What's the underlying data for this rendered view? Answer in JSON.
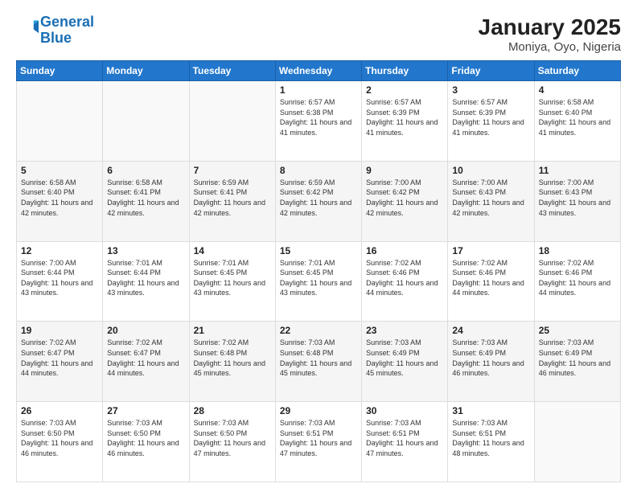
{
  "header": {
    "logo_text_general": "General",
    "logo_text_blue": "Blue",
    "month_year": "January 2025",
    "location": "Moniya, Oyo, Nigeria"
  },
  "weekdays": [
    "Sunday",
    "Monday",
    "Tuesday",
    "Wednesday",
    "Thursday",
    "Friday",
    "Saturday"
  ],
  "weeks": [
    [
      {
        "day": "",
        "info": ""
      },
      {
        "day": "",
        "info": ""
      },
      {
        "day": "",
        "info": ""
      },
      {
        "day": "1",
        "info": "Sunrise: 6:57 AM\nSunset: 6:38 PM\nDaylight: 11 hours and 41 minutes."
      },
      {
        "day": "2",
        "info": "Sunrise: 6:57 AM\nSunset: 6:39 PM\nDaylight: 11 hours and 41 minutes."
      },
      {
        "day": "3",
        "info": "Sunrise: 6:57 AM\nSunset: 6:39 PM\nDaylight: 11 hours and 41 minutes."
      },
      {
        "day": "4",
        "info": "Sunrise: 6:58 AM\nSunset: 6:40 PM\nDaylight: 11 hours and 41 minutes."
      }
    ],
    [
      {
        "day": "5",
        "info": "Sunrise: 6:58 AM\nSunset: 6:40 PM\nDaylight: 11 hours and 42 minutes."
      },
      {
        "day": "6",
        "info": "Sunrise: 6:58 AM\nSunset: 6:41 PM\nDaylight: 11 hours and 42 minutes."
      },
      {
        "day": "7",
        "info": "Sunrise: 6:59 AM\nSunset: 6:41 PM\nDaylight: 11 hours and 42 minutes."
      },
      {
        "day": "8",
        "info": "Sunrise: 6:59 AM\nSunset: 6:42 PM\nDaylight: 11 hours and 42 minutes."
      },
      {
        "day": "9",
        "info": "Sunrise: 7:00 AM\nSunset: 6:42 PM\nDaylight: 11 hours and 42 minutes."
      },
      {
        "day": "10",
        "info": "Sunrise: 7:00 AM\nSunset: 6:43 PM\nDaylight: 11 hours and 42 minutes."
      },
      {
        "day": "11",
        "info": "Sunrise: 7:00 AM\nSunset: 6:43 PM\nDaylight: 11 hours and 43 minutes."
      }
    ],
    [
      {
        "day": "12",
        "info": "Sunrise: 7:00 AM\nSunset: 6:44 PM\nDaylight: 11 hours and 43 minutes."
      },
      {
        "day": "13",
        "info": "Sunrise: 7:01 AM\nSunset: 6:44 PM\nDaylight: 11 hours and 43 minutes."
      },
      {
        "day": "14",
        "info": "Sunrise: 7:01 AM\nSunset: 6:45 PM\nDaylight: 11 hours and 43 minutes."
      },
      {
        "day": "15",
        "info": "Sunrise: 7:01 AM\nSunset: 6:45 PM\nDaylight: 11 hours and 43 minutes."
      },
      {
        "day": "16",
        "info": "Sunrise: 7:02 AM\nSunset: 6:46 PM\nDaylight: 11 hours and 44 minutes."
      },
      {
        "day": "17",
        "info": "Sunrise: 7:02 AM\nSunset: 6:46 PM\nDaylight: 11 hours and 44 minutes."
      },
      {
        "day": "18",
        "info": "Sunrise: 7:02 AM\nSunset: 6:46 PM\nDaylight: 11 hours and 44 minutes."
      }
    ],
    [
      {
        "day": "19",
        "info": "Sunrise: 7:02 AM\nSunset: 6:47 PM\nDaylight: 11 hours and 44 minutes."
      },
      {
        "day": "20",
        "info": "Sunrise: 7:02 AM\nSunset: 6:47 PM\nDaylight: 11 hours and 44 minutes."
      },
      {
        "day": "21",
        "info": "Sunrise: 7:02 AM\nSunset: 6:48 PM\nDaylight: 11 hours and 45 minutes."
      },
      {
        "day": "22",
        "info": "Sunrise: 7:03 AM\nSunset: 6:48 PM\nDaylight: 11 hours and 45 minutes."
      },
      {
        "day": "23",
        "info": "Sunrise: 7:03 AM\nSunset: 6:49 PM\nDaylight: 11 hours and 45 minutes."
      },
      {
        "day": "24",
        "info": "Sunrise: 7:03 AM\nSunset: 6:49 PM\nDaylight: 11 hours and 46 minutes."
      },
      {
        "day": "25",
        "info": "Sunrise: 7:03 AM\nSunset: 6:49 PM\nDaylight: 11 hours and 46 minutes."
      }
    ],
    [
      {
        "day": "26",
        "info": "Sunrise: 7:03 AM\nSunset: 6:50 PM\nDaylight: 11 hours and 46 minutes."
      },
      {
        "day": "27",
        "info": "Sunrise: 7:03 AM\nSunset: 6:50 PM\nDaylight: 11 hours and 46 minutes."
      },
      {
        "day": "28",
        "info": "Sunrise: 7:03 AM\nSunset: 6:50 PM\nDaylight: 11 hours and 47 minutes."
      },
      {
        "day": "29",
        "info": "Sunrise: 7:03 AM\nSunset: 6:51 PM\nDaylight: 11 hours and 47 minutes."
      },
      {
        "day": "30",
        "info": "Sunrise: 7:03 AM\nSunset: 6:51 PM\nDaylight: 11 hours and 47 minutes."
      },
      {
        "day": "31",
        "info": "Sunrise: 7:03 AM\nSunset: 6:51 PM\nDaylight: 11 hours and 48 minutes."
      },
      {
        "day": "",
        "info": ""
      }
    ]
  ]
}
